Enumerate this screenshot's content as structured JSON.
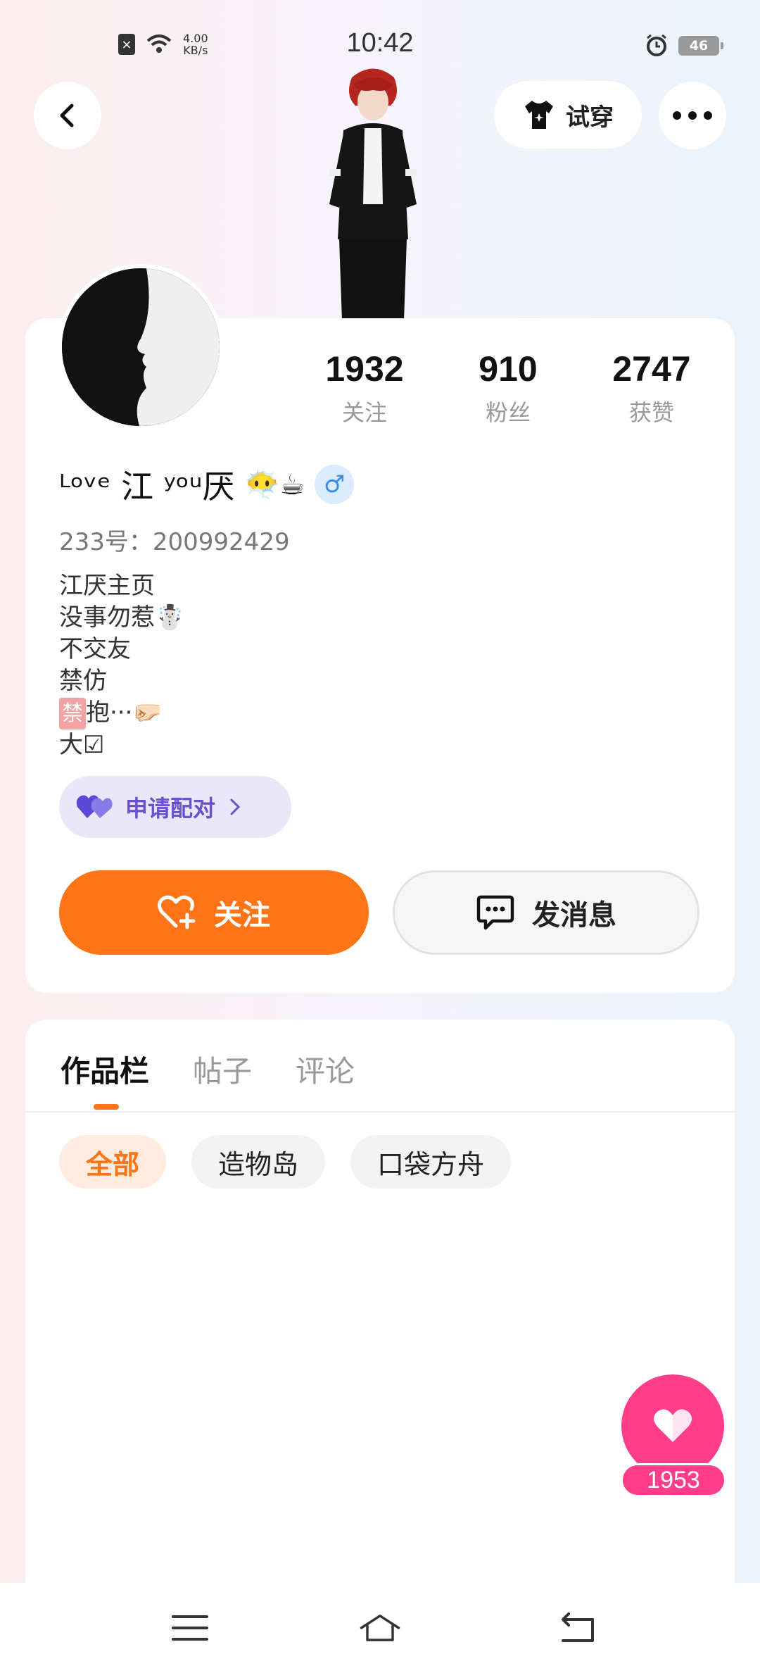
{
  "status_bar": {
    "time": "10:42",
    "net_speed_value": "4.00",
    "net_speed_unit": "KB/s",
    "battery": "46"
  },
  "header": {
    "try_on_label": "试穿"
  },
  "profile": {
    "stats": [
      {
        "value": "1932",
        "label": "关注"
      },
      {
        "value": "910",
        "label": "粉丝"
      },
      {
        "value": "2747",
        "label": "获赞"
      }
    ],
    "name": "ᴸᵒᵛᵉ 江 ʸᵒᵘ厌",
    "name_emoji": "😶‍🌫️☕",
    "gender_symbol": "♂",
    "uid": "233号：200992429",
    "bio": [
      "江厌主页",
      "没事勿惹☃️",
      "不交友",
      "禁仿",
      "抱···🤛🏻",
      "大☑"
    ],
    "bio_ban_badge": "禁",
    "pair_label": "申请配对",
    "follow_label": "关注",
    "message_label": "发消息"
  },
  "works": {
    "tabs": [
      "作品栏",
      "帖子",
      "评论"
    ],
    "active_tab": "作品栏",
    "chips": [
      "全部",
      "造物岛",
      "口袋方舟"
    ],
    "active_chip": "全部"
  },
  "like_fab": {
    "count": "1953"
  },
  "colors": {
    "accent_orange": "#ff7417",
    "pair_purple": "#6a52cf",
    "like_pink": "#ff3d8b"
  }
}
